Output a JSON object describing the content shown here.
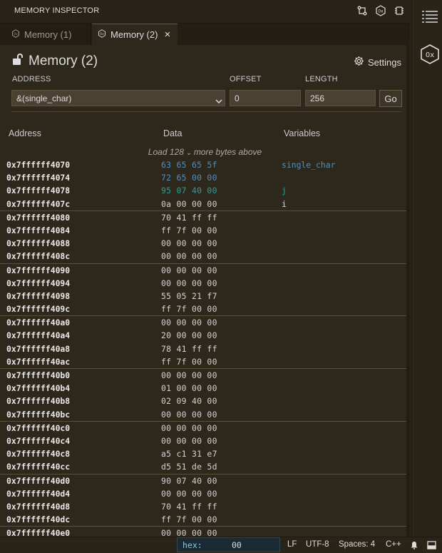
{
  "panel": {
    "title": "MEMORY INSPECTOR",
    "toolbar_icons": [
      "split-icon",
      "hex-icon",
      "chip-icon"
    ]
  },
  "tabs": [
    {
      "label": "Memory (1)",
      "active": false
    },
    {
      "label": "Memory (2)",
      "active": true
    }
  ],
  "header": {
    "title": "Memory (2)",
    "settings_label": "Settings"
  },
  "form": {
    "address_label": "ADDRESS",
    "offset_label": "OFFSET",
    "length_label": "LENGTH",
    "address_value": "&(single_char)",
    "offset_value": "0",
    "length_value": "256",
    "go_label": "Go"
  },
  "table": {
    "col_address": "Address",
    "col_data": "Data",
    "col_variables": "Variables",
    "load_prefix": "Load",
    "load_count": "128",
    "load_suffix": "more bytes above",
    "rows": [
      {
        "address": "0x7ffffff4070",
        "bytes": "63 65 65 5f",
        "var": "single_char"
      },
      {
        "address": "0x7ffffff4074",
        "bytes": "72 65 00 00",
        "var": ""
      },
      {
        "address": "0x7ffffff4078",
        "bytes": "95 07 40 00",
        "var": "j"
      },
      {
        "address": "0x7ffffff407c",
        "bytes": "0a 00 00 00",
        "var": "i"
      },
      {
        "address": "0x7ffffff4080",
        "bytes": "70 41 ff ff",
        "var": ""
      },
      {
        "address": "0x7ffffff4084",
        "bytes": "ff 7f 00 00",
        "var": ""
      },
      {
        "address": "0x7ffffff4088",
        "bytes": "00 00 00 00",
        "var": ""
      },
      {
        "address": "0x7ffffff408c",
        "bytes": "00 00 00 00",
        "var": ""
      },
      {
        "address": "0x7ffffff4090",
        "bytes": "00 00 00 00",
        "var": ""
      },
      {
        "address": "0x7ffffff4094",
        "bytes": "00 00 00 00",
        "var": ""
      },
      {
        "address": "0x7ffffff4098",
        "bytes": "55 05 21 f7",
        "var": ""
      },
      {
        "address": "0x7ffffff409c",
        "bytes": "ff 7f 00 00",
        "var": ""
      },
      {
        "address": "0x7ffffff40a0",
        "bytes": "00 00 00 00",
        "var": ""
      },
      {
        "address": "0x7ffffff40a4",
        "bytes": "20 00 00 00",
        "var": ""
      },
      {
        "address": "0x7ffffff40a8",
        "bytes": "78 41 ff ff",
        "var": ""
      },
      {
        "address": "0x7ffffff40ac",
        "bytes": "ff 7f 00 00",
        "var": ""
      },
      {
        "address": "0x7ffffff40b0",
        "bytes": "00 00 00 00",
        "var": ""
      },
      {
        "address": "0x7ffffff40b4",
        "bytes": "01 00 00 00",
        "var": ""
      },
      {
        "address": "0x7ffffff40b8",
        "bytes": "02 09 40 00",
        "var": ""
      },
      {
        "address": "0x7ffffff40bc",
        "bytes": "00 00 00 00",
        "var": ""
      },
      {
        "address": "0x7ffffff40c0",
        "bytes": "00 00 00 00",
        "var": ""
      },
      {
        "address": "0x7ffffff40c4",
        "bytes": "00 00 00 00",
        "var": ""
      },
      {
        "address": "0x7ffffff40c8",
        "bytes": "a5 c1 31 e7",
        "var": ""
      },
      {
        "address": "0x7ffffff40cc",
        "bytes": "d5 51 de 5d",
        "var": ""
      },
      {
        "address": "0x7ffffff40d0",
        "bytes": "90 07 40 00",
        "var": ""
      },
      {
        "address": "0x7ffffff40d4",
        "bytes": "00 00 00 00",
        "var": ""
      },
      {
        "address": "0x7ffffff40d8",
        "bytes": "70 41 ff ff",
        "var": ""
      },
      {
        "address": "0x7ffffff40dc",
        "bytes": "ff 7f 00 00",
        "var": ""
      },
      {
        "address": "0x7ffffff40e0",
        "bytes": "00 00 00 00",
        "var": ""
      }
    ]
  },
  "status": {
    "hex_label": "hex:",
    "hex_value": "00",
    "eol": "LF",
    "encoding": "UTF-8",
    "indent": "Spaces: 4",
    "language": "C++"
  },
  "colors": {
    "accent": "#0078d4",
    "variable_text": "#4e8fc4",
    "panel_bg": "#2e271c"
  }
}
